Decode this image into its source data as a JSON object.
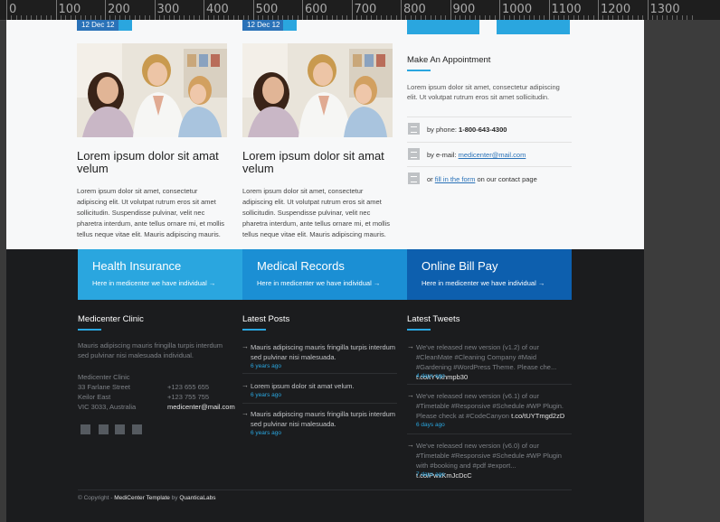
{
  "ruler": {
    "labels": [
      "0",
      "100",
      "200",
      "300",
      "400",
      "500",
      "600",
      "700",
      "800",
      "900",
      "1000",
      "1100",
      "1200",
      "1300"
    ]
  },
  "posts": [
    {
      "date": "12 Dec 12",
      "title": "Lorem ipsum dolor sit amat velum",
      "text": "Lorem ipsum dolor sit amet, consectetur adipiscing elit. Ut volutpat rutrum eros sit amet sollicitudin. Suspendisse pulvinar, velit nec pharetra interdum, ante tellus ornare mi, et mollis tellus neque vitae elit. Mauris adipiscing mauris."
    },
    {
      "date": "12 Dec 12",
      "title": "Lorem ipsum dolor sit amat velum",
      "text": "Lorem ipsum dolor sit amet, consectetur adipiscing elit. Ut volutpat rutrum eros sit amet sollicitudin. Suspendisse pulvinar, velit nec pharetra interdum, ante tellus ornare mi, et mollis tellus neque vitae elit. Mauris adipiscing mauris."
    }
  ],
  "appointment": {
    "title": "Make An Appointment",
    "text": "Lorem ipsum dolor sit amet, consectetur adipiscing elit. Ut volutpat rutrum eros sit amet sollicitudin.",
    "phone_prefix": "by phone:",
    "phone": "1-800-643-4300",
    "email_prefix": "by e-mail:",
    "email": "medicenter@mail.com",
    "form_prefix": "or",
    "form_link": "fill in the form",
    "form_suffix": "on our contact page"
  },
  "cta": [
    {
      "title": "Health Insurance",
      "sub": "Here in medicenter we have individual  →",
      "color": "#2aa6df"
    },
    {
      "title": "Medical Records",
      "sub": "Here in medicenter we have individual  →",
      "color": "#1b8fd4"
    },
    {
      "title": "Online Bill Pay",
      "sub": "Here in medicenter we have individual  →",
      "color": "#0d5fae"
    }
  ],
  "footer": {
    "clinic": {
      "title": "Medicenter Clinic",
      "text": "Mauris adipiscing mauris fringilla turpis interdum sed pulvinar nisi malesuada individual.",
      "address": [
        "Medicenter Clinic",
        "33 Farlane Street",
        "Keilor East",
        "VIC 3033, Australia"
      ],
      "phones": [
        "+123 655 655",
        "+123 755 755"
      ],
      "email": "medicenter@mail.com"
    },
    "latest_posts": {
      "title": "Latest Posts",
      "items": [
        {
          "text": "Mauris adipiscing mauris fringilla turpis interdum sed pulvinar nisi malesuada.",
          "ago": "6 years ago"
        },
        {
          "text": "Lorem ipsum dolor sit amat velum.",
          "ago": "6 years ago"
        },
        {
          "text": "Mauris adipiscing mauris fringilla turpis interdum sed pulvinar nisi malesuada.",
          "ago": "6 years ago"
        }
      ]
    },
    "latest_tweets": {
      "title": "Latest Tweets",
      "items": [
        {
          "text": "We've released new version (v1.2) of our #CleanMate #Cleaning Company #Maid #Gardening #WordPress Theme. Please che... ",
          "link": "t.co/tYVkhmpb30",
          "ago": "4 days ago"
        },
        {
          "text": "We've released new version (v6.1) of our #Timetable #Responsive #Schedule #WP Plugin. Please check at #CodeCanyon ",
          "link": "t.co/tUYTmgd2zD",
          "ago": "6 days ago"
        },
        {
          "text": "We've released new version (v6.0) of our #Timetable #Responsive #Schedule #WP Plugin with #booking and #pdf #export... ",
          "link": "t.co/PwxKmJcDcC",
          "ago": "7 days ago"
        }
      ]
    },
    "copyright_prefix": "© Copyright - ",
    "copyright_brand": "MediCenter Template",
    "copyright_by": " by ",
    "copyright_author": "QuanticaLabs"
  }
}
